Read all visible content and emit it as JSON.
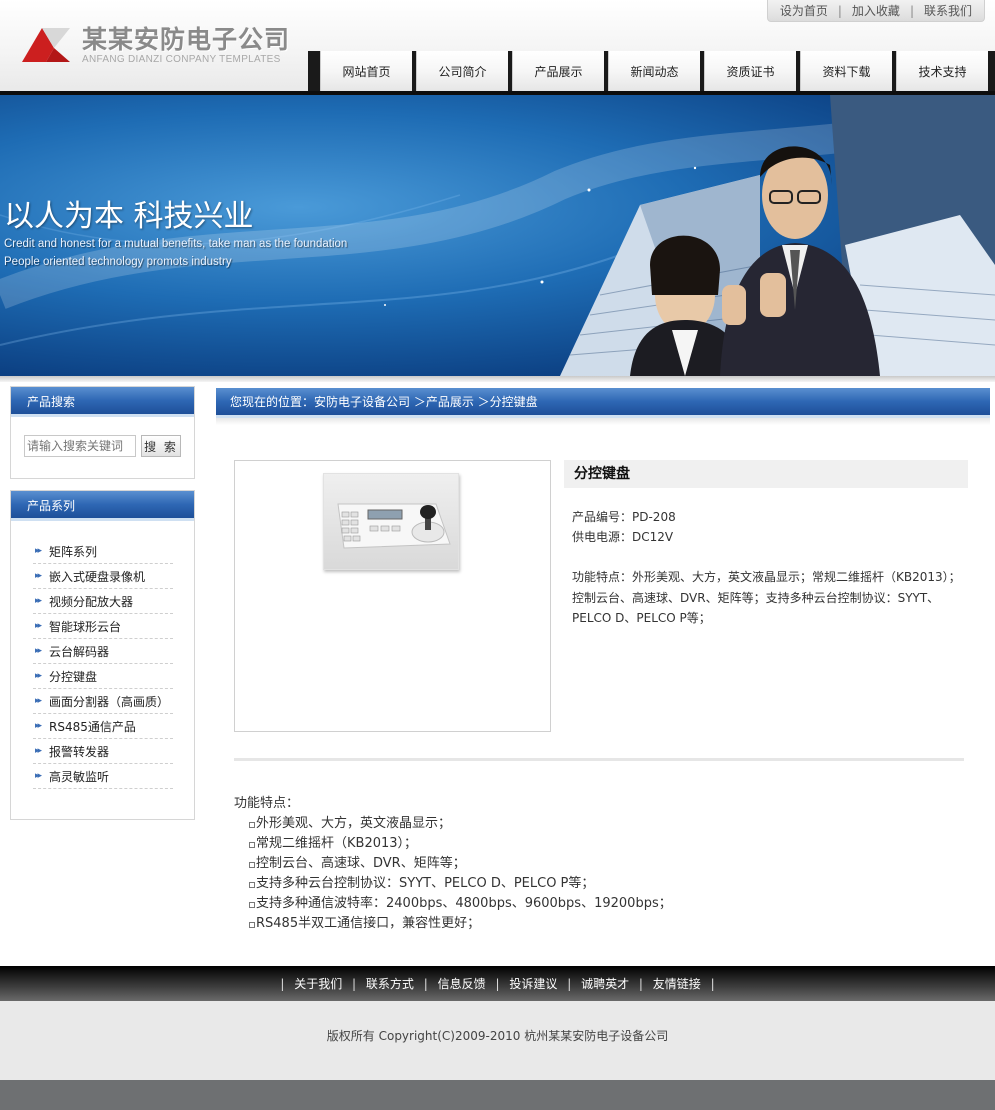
{
  "header": {
    "logo_cn": "某某安防电子公司",
    "logo_en": "ANFANG DIANZI CONPANY TEMPLATES",
    "top_links": [
      "设为首页",
      "加入收藏",
      "联系我们"
    ],
    "nav": [
      "网站首页",
      "公司简介",
      "产品展示",
      "新闻动态",
      "资质证书",
      "资料下载",
      "技术支持"
    ]
  },
  "banner": {
    "title": "以人为本 科技兴业",
    "line1": "Credit and honest for a mutual benefits, take man as the foundation",
    "line2": "People oriented technology promots industry"
  },
  "sidebar": {
    "search_title": "产品搜索",
    "search_placeholder": "请输入搜索关键词",
    "search_button": "搜 索",
    "category_title": "产品系列",
    "categories": [
      "矩阵系列",
      "嵌入式硬盘录像机",
      "视频分配放大器",
      "智能球形云台",
      "云台解码器",
      "分控键盘",
      "画面分割器（高画质）",
      "RS485通信产品",
      "报警转发器",
      "高灵敏监听"
    ]
  },
  "breadcrumb": "您现在的位置：安防电子设备公司 ＞产品展示 ＞分控键盘",
  "product": {
    "title": "分控键盘",
    "code": "产品编号：PD-208",
    "power": "供电电源：DC12V",
    "features_short": "功能特点：外形美观、大方，英文液晶显示；常规二维摇杆（KB2013）；控制云台、高速球、DVR、矩阵等；支持多种云台控制协议：SYYT、PELCO D、PELCO P等；",
    "detail_heading": "功能特点：",
    "detail_items": [
      "外形美观、大方，英文液晶显示；",
      "常规二维摇杆（KB2013）；",
      "控制云台、高速球、DVR、矩阵等；",
      "支持多种云台控制协议：SYYT、PELCO D、PELCO P等；",
      "支持多种通信波特率：2400bps、4800bps、9600bps、19200bps；",
      "RS485半双工通信接口，兼容性更好；"
    ]
  },
  "footer": {
    "links": [
      "关于我们",
      "联系方式",
      "信息反馈",
      "投诉建议",
      "诚聘英才",
      "友情链接"
    ],
    "copyright": "版权所有  Copyright(C)2009-2010 杭州某某安防电子设备公司"
  },
  "colors": {
    "nav_bar": "#1a1a1a",
    "sidebar_header": "#2e67b4",
    "logo_red": "#cc1f1f",
    "banner_blue": "#1e6cb4"
  }
}
